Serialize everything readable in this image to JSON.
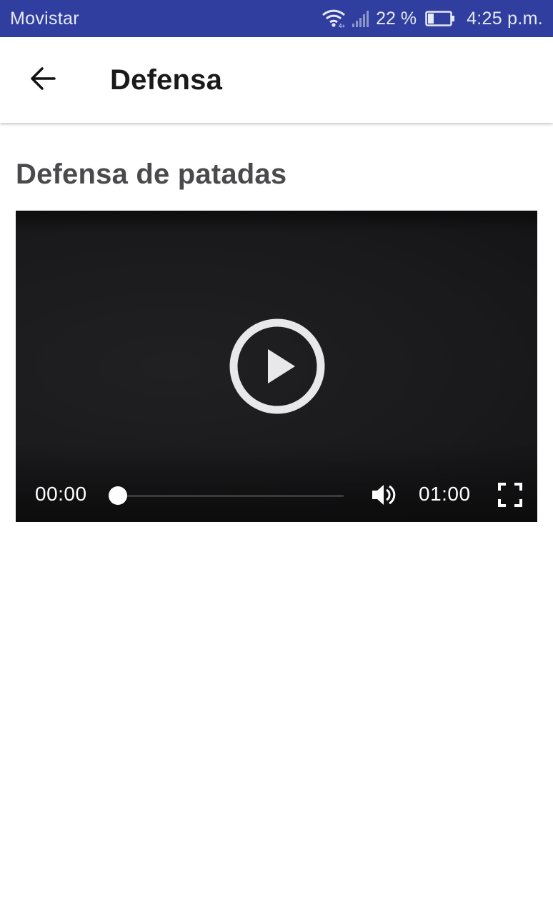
{
  "status_bar": {
    "carrier": "Movistar",
    "battery_percent": "22 %",
    "time": "4:25 p.m.",
    "icons": [
      "wifi-icon",
      "signal-icon",
      "battery-icon"
    ],
    "background_color": "#303f9f"
  },
  "app_bar": {
    "title": "Defensa",
    "back_icon": "arrow-left-icon"
  },
  "content": {
    "section_title": "Defensa de patadas",
    "video": {
      "current_time": "00:00",
      "duration": "01:00",
      "progress": 0.0,
      "icons": [
        "play-circle-icon",
        "volume-icon",
        "fullscreen-icon"
      ]
    }
  }
}
